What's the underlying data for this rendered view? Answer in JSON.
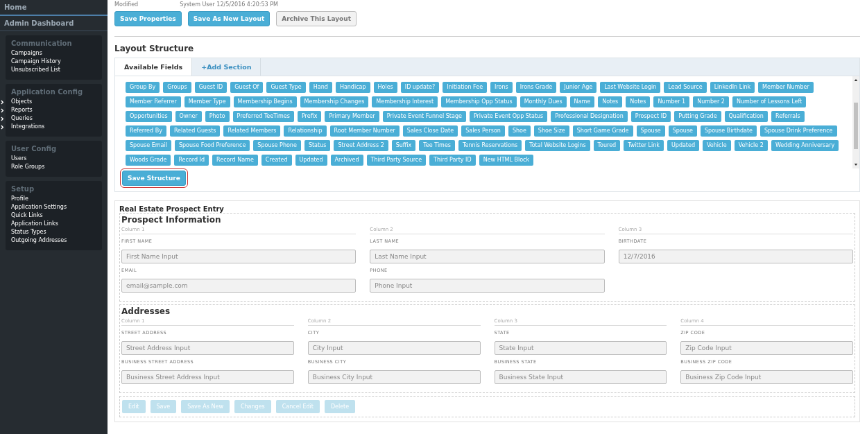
{
  "sidebar": {
    "top_items": [
      {
        "label": "Home",
        "selected": true
      },
      {
        "label": "Admin Dashboard",
        "selected": false
      }
    ],
    "groups": [
      {
        "title": "Communication",
        "items": [
          {
            "label": "Campaigns",
            "expandable": false
          },
          {
            "label": "Campaign History",
            "expandable": false
          },
          {
            "label": "Unsubscribed List",
            "expandable": false
          }
        ]
      },
      {
        "title": "Application Config",
        "items": [
          {
            "label": "Objects",
            "expandable": true
          },
          {
            "label": "Reports",
            "expandable": true
          },
          {
            "label": "Queries",
            "expandable": true
          },
          {
            "label": "Integrations",
            "expandable": true
          }
        ]
      },
      {
        "title": "User Config",
        "items": [
          {
            "label": "Users",
            "expandable": false
          },
          {
            "label": "Role Groups",
            "expandable": false
          }
        ]
      },
      {
        "title": "Setup",
        "items": [
          {
            "label": "Profile",
            "expandable": false
          },
          {
            "label": "Application Settings",
            "expandable": false
          },
          {
            "label": "Quick Links",
            "expandable": false
          },
          {
            "label": "Application Links",
            "expandable": false
          },
          {
            "label": "Status Types",
            "expandable": false
          },
          {
            "label": "Outgoing Addresses",
            "expandable": false
          }
        ]
      }
    ]
  },
  "modified": {
    "label": "Modified",
    "value": "System User 12/5/2016 4:20:53 PM"
  },
  "top_buttons": [
    {
      "label": "Save Properties",
      "kind": "primary"
    },
    {
      "label": "Save As New Layout",
      "kind": "primary"
    },
    {
      "label": "Archive This Layout",
      "kind": "secondary"
    }
  ],
  "layout_structure": {
    "title": "Layout Structure",
    "tabs": [
      {
        "label": "Available Fields",
        "selected": true
      },
      {
        "label": "+Add Section",
        "selected": false
      }
    ],
    "fields": [
      "Group By",
      "Groups",
      "Guest ID",
      "Guest Of",
      "Guest Type",
      "Hand",
      "Handicap",
      "Holes",
      "ID update?",
      "Initiation Fee",
      "Irons",
      "Irons Grade",
      "Junior Age",
      "Last Website Login",
      "Lead Source",
      "LinkedIn Link",
      "Member Number",
      "Member Referrer",
      "Member Type",
      "Membership Begins",
      "Membership Changes",
      "Membership Interest",
      "Membership Opp Status",
      "Monthly Dues",
      "Name",
      "Notes",
      "Notes",
      "Number 1",
      "Number 2",
      "Number of Lessons Left",
      "Opportunities",
      "Owner",
      "Photo",
      "Preferred TeeTimes",
      "Prefix",
      "Primary Member",
      "Private Event Funnel Stage",
      "Private Event Opp Status",
      "Professional Designation",
      "Prospect ID",
      "Putting Grade",
      "Qualification",
      "Referrals",
      "Referred By",
      "Related Guests",
      "Related Members",
      "Relationship",
      "Root Member Number",
      "Sales Close Date",
      "Sales Person",
      "Shoe",
      "Shoe Size",
      "Short Game Grade",
      "Spouse",
      "Spouse",
      "Spouse Birthdate",
      "Spouse Drink Preference",
      "Spouse Email",
      "Spouse Food Preference",
      "Spouse Phone",
      "Status",
      "Street Address 2",
      "Suffix",
      "Tee Times",
      "Tennis Reservations",
      "Total Website Logins",
      "Toured",
      "Twitter Link",
      "Updated",
      "Vehicle",
      "Vehicle 2",
      "Wedding Anniversary",
      "Woods Grade",
      "Record Id",
      "Record Name",
      "Created",
      "Updated",
      "Archived",
      "Third Party Source",
      "Third Party ID",
      "New HTML Block"
    ],
    "save_button": "Save Structure"
  },
  "form": {
    "title": "Real Estate Prospect Entry",
    "sections": [
      {
        "title": "Prospect Information",
        "columns": [
          {
            "label": "Column 1",
            "fields": [
              {
                "label": "FIRST NAME",
                "placeholder": "First Name Input"
              },
              {
                "label": "EMAIL",
                "value": "email@sample.com"
              }
            ]
          },
          {
            "label": "Column 2",
            "fields": [
              {
                "label": "LAST NAME",
                "placeholder": "Last Name Input"
              },
              {
                "label": "PHONE",
                "placeholder": "Phone Input"
              }
            ]
          },
          {
            "label": "Column 3",
            "fields": [
              {
                "label": "BIRTHDATE",
                "value": "12/7/2016"
              }
            ]
          }
        ]
      },
      {
        "title": "Addresses",
        "columns": [
          {
            "label": "Column 1",
            "fields": [
              {
                "label": "STREET ADDRESS",
                "placeholder": "Street Address Input"
              },
              {
                "label": "BUSINESS STREET ADDRESS",
                "placeholder": "Business Street Address Input"
              }
            ]
          },
          {
            "label": "Column 2",
            "fields": [
              {
                "label": "CITY",
                "placeholder": "City Input"
              },
              {
                "label": "BUSINESS CITY",
                "placeholder": "Business City Input"
              }
            ]
          },
          {
            "label": "Column 3",
            "fields": [
              {
                "label": "STATE",
                "placeholder": "State Input"
              },
              {
                "label": "BUSINESS STATE",
                "placeholder": "Business State Input"
              }
            ]
          },
          {
            "label": "Column 4",
            "fields": [
              {
                "label": "ZIP CODE",
                "placeholder": "Zip Code Input"
              },
              {
                "label": "BUSINESS ZIP CODE",
                "placeholder": "Business Zip Code Input"
              }
            ]
          }
        ]
      }
    ],
    "buttons": [
      {
        "label": "Edit",
        "disabled": true
      },
      {
        "label": "Save",
        "disabled": true
      },
      {
        "label": "Save As New",
        "disabled": true
      },
      {
        "label": "Changes",
        "disabled": true
      },
      {
        "label": "Cancel Edit",
        "disabled": true
      },
      {
        "label": "Delete",
        "disabled": true
      }
    ]
  }
}
